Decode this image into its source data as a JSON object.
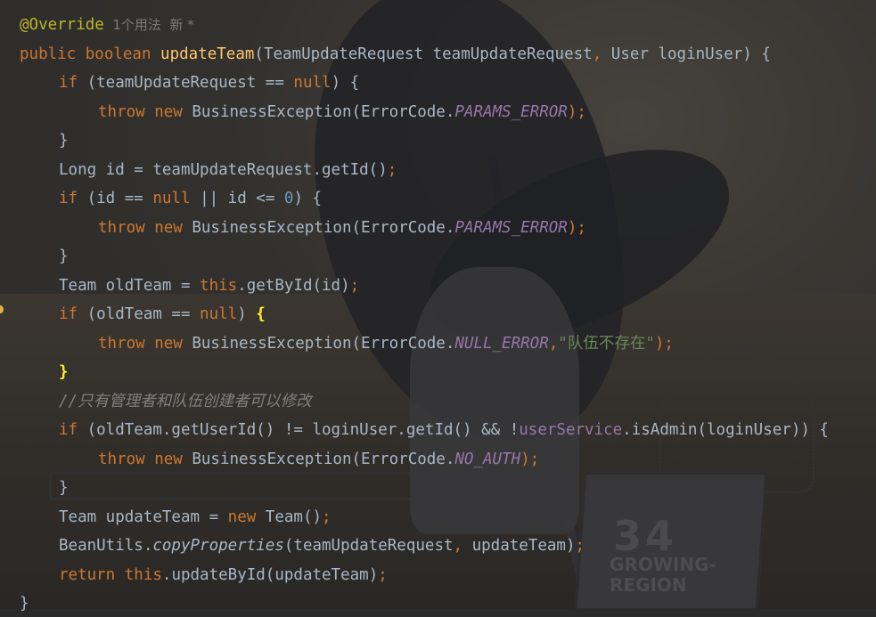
{
  "editor": {
    "colors": {
      "keyword": "#cc7832",
      "method_declaration": "#ffc66d",
      "constant": "#9876aa",
      "string": "#6a8759",
      "number": "#6897bb",
      "annotation": "#bbb529",
      "comment": "#808080",
      "default_text": "#a9b7c6"
    },
    "gutter_marker": "bulb-icon",
    "lines": [
      {
        "tokens": [
          {
            "t": "@Override",
            "c": "an"
          },
          {
            "t": "  1个用法  新 *",
            "c": "hint"
          }
        ]
      },
      {
        "tokens": [
          {
            "t": "public boolean ",
            "c": "kw"
          },
          {
            "t": "updateTeam",
            "c": "fn"
          },
          {
            "t": "(TeamUpdateRequest teamUpdateRequest",
            "c": ""
          },
          {
            "t": ",",
            "c": "kw"
          },
          {
            "t": " User loginUser) {",
            "c": ""
          }
        ]
      },
      {
        "tokens": [
          {
            "t": "if",
            "c": "kw"
          },
          {
            "t": " (teamUpdateRequest == ",
            "c": ""
          },
          {
            "t": "null",
            "c": "kw"
          },
          {
            "t": ") {",
            "c": ""
          }
        ]
      },
      {
        "tokens": [
          {
            "t": "throw new",
            "c": "kw"
          },
          {
            "t": " BusinessException(ErrorCode.",
            "c": ""
          },
          {
            "t": "PARAMS_ERROR",
            "c": "cn"
          },
          {
            "t": ");",
            "c": "kw"
          }
        ]
      },
      {
        "tokens": [
          {
            "t": "}",
            "c": ""
          }
        ]
      },
      {
        "tokens": [
          {
            "t": "Long id = teamUpdateRequest.getId()",
            "c": ""
          },
          {
            "t": ";",
            "c": "kw"
          }
        ]
      },
      {
        "tokens": [
          {
            "t": "if",
            "c": "kw"
          },
          {
            "t": " (id == ",
            "c": ""
          },
          {
            "t": "null",
            "c": "kw"
          },
          {
            "t": " || id <= ",
            "c": ""
          },
          {
            "t": "0",
            "c": "nu"
          },
          {
            "t": ") {",
            "c": ""
          }
        ]
      },
      {
        "tokens": [
          {
            "t": "throw new",
            "c": "kw"
          },
          {
            "t": " BusinessException(ErrorCode.",
            "c": ""
          },
          {
            "t": "PARAMS_ERROR",
            "c": "cn"
          },
          {
            "t": ");",
            "c": "kw"
          }
        ]
      },
      {
        "tokens": [
          {
            "t": "}",
            "c": ""
          }
        ]
      },
      {
        "tokens": [
          {
            "t": "Team oldTeam = ",
            "c": ""
          },
          {
            "t": "this",
            "c": "kw"
          },
          {
            "t": ".getById(id)",
            "c": ""
          },
          {
            "t": ";",
            "c": "kw"
          }
        ]
      },
      {
        "tokens": [
          {
            "t": "if",
            "c": "kw"
          },
          {
            "t": " (oldTeam == ",
            "c": ""
          },
          {
            "t": "null",
            "c": "kw"
          },
          {
            "t": ") ",
            "c": ""
          },
          {
            "t": "{",
            "c": "brace-hl"
          }
        ]
      },
      {
        "tokens": [
          {
            "t": "throw new",
            "c": "kw"
          },
          {
            "t": " BusinessException(ErrorCode.",
            "c": ""
          },
          {
            "t": "NULL_ERROR",
            "c": "cn"
          },
          {
            "t": ",",
            "c": "kw"
          },
          {
            "t": "\"队伍不存在\"",
            "c": "st"
          },
          {
            "t": ");",
            "c": "kw"
          }
        ]
      },
      {
        "tokens": [
          {
            "t": "}",
            "c": "brace-hl"
          }
        ]
      },
      {
        "tokens": [
          {
            "t": "//只有管理者和队伍创建者可以修改",
            "c": "cm"
          }
        ]
      },
      {
        "tokens": [
          {
            "t": "if",
            "c": "kw"
          },
          {
            "t": " (oldTeam.getUserId() != loginUser.getId() && !",
            "c": ""
          },
          {
            "t": "userService",
            "c": "fd"
          },
          {
            "t": ".isAdmin(loginUser)) {",
            "c": ""
          }
        ]
      },
      {
        "tokens": [
          {
            "t": "throw new",
            "c": "kw"
          },
          {
            "t": " BusinessException(ErrorCode.",
            "c": ""
          },
          {
            "t": "NO_AUTH",
            "c": "cn"
          },
          {
            "t": ");",
            "c": "kw"
          }
        ]
      },
      {
        "tokens": [
          {
            "t": "}",
            "c": ""
          }
        ]
      },
      {
        "tokens": [
          {
            "t": "Team updateTeam = ",
            "c": ""
          },
          {
            "t": "new",
            "c": "kw"
          },
          {
            "t": " Team()",
            "c": ""
          },
          {
            "t": ";",
            "c": "kw"
          }
        ]
      },
      {
        "tokens": [
          {
            "t": "BeanUtils.",
            "c": ""
          },
          {
            "t": "copyProperties",
            "c": "sm"
          },
          {
            "t": "(teamUpdateRequest",
            "c": ""
          },
          {
            "t": ",",
            "c": "kw"
          },
          {
            "t": " updateTeam)",
            "c": ""
          },
          {
            "t": ";",
            "c": "kw"
          }
        ]
      },
      {
        "tokens": [
          {
            "t": "return this",
            "c": "kw"
          },
          {
            "t": ".updateById(updateTeam)",
            "c": ""
          },
          {
            "t": ";",
            "c": "kw"
          }
        ]
      },
      {
        "tokens": [
          {
            "t": "}",
            "c": ""
          }
        ]
      }
    ]
  },
  "background": {
    "sign_number": "34",
    "sign_line1": "GROWING-",
    "sign_line2": "REGION"
  }
}
